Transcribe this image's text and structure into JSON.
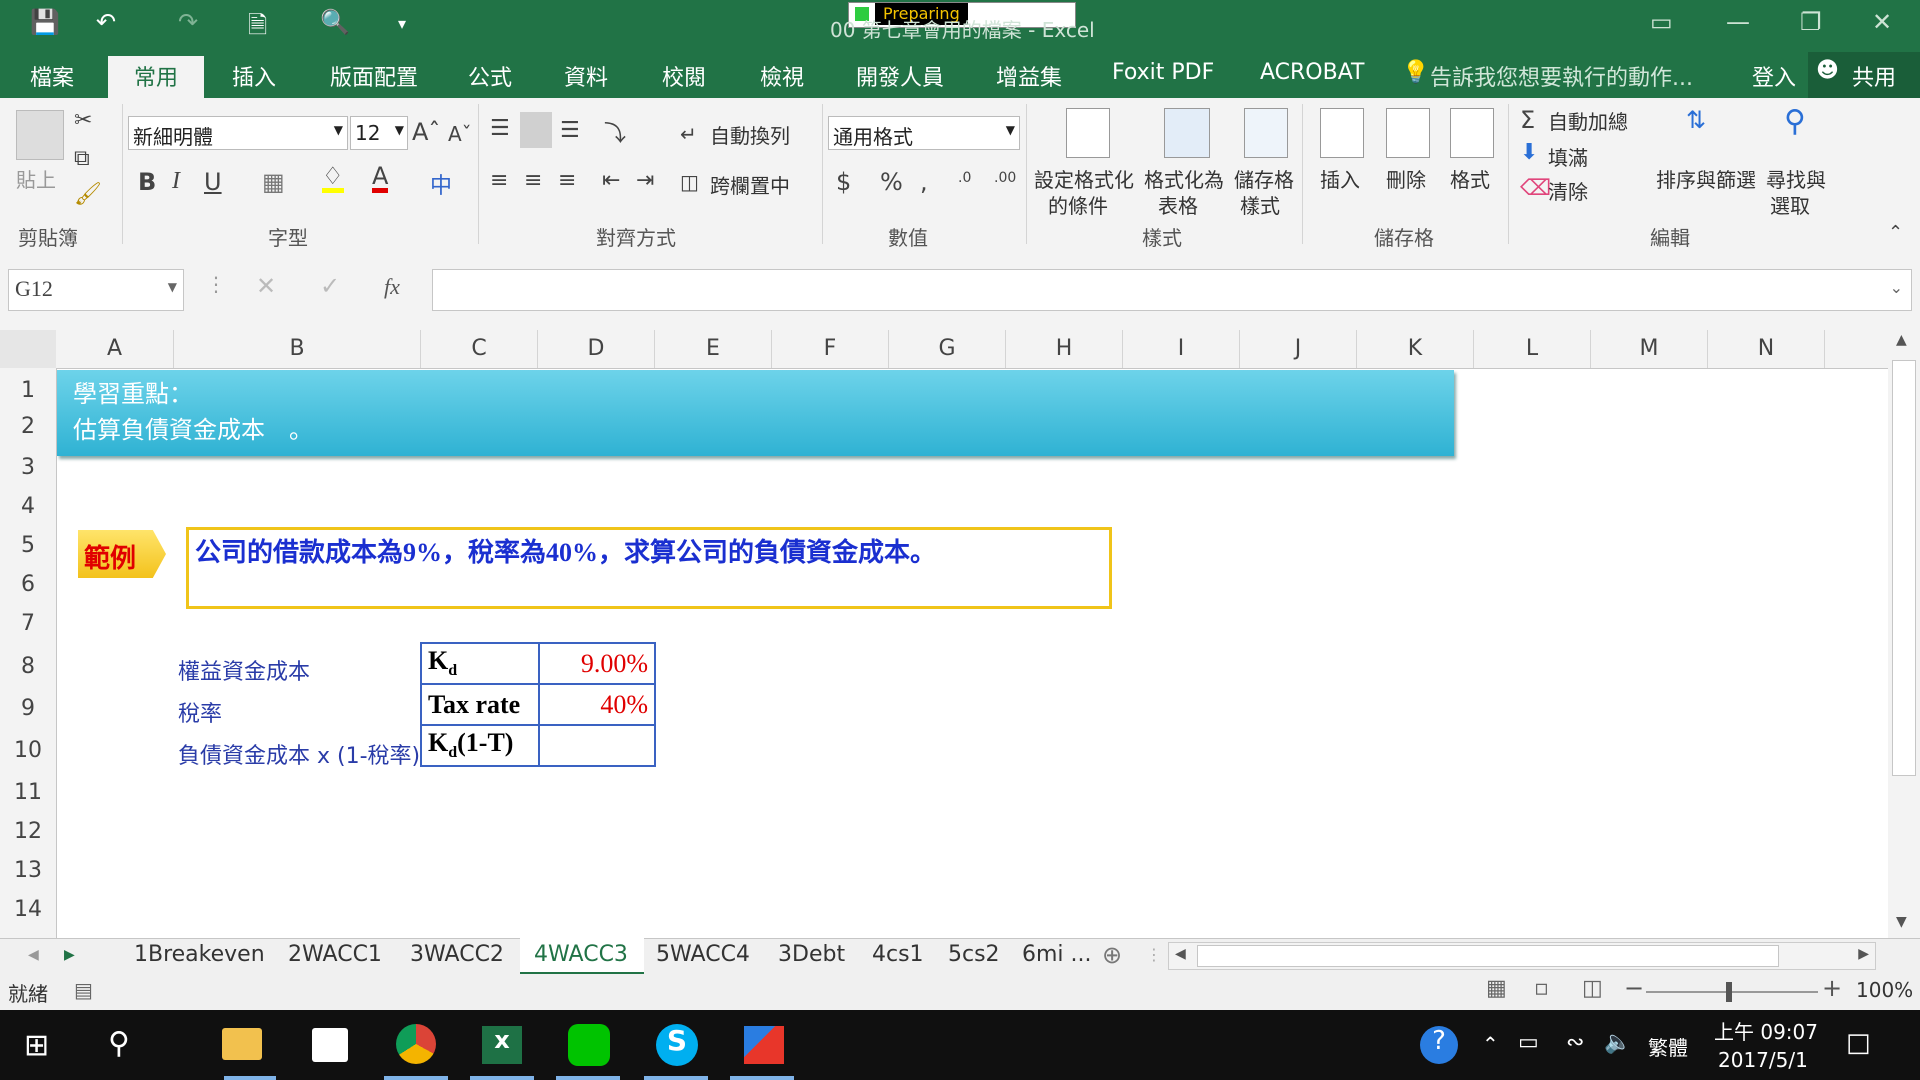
{
  "window": {
    "title": "00 第七章會用的檔案 - Excel",
    "status_popup": "Preparing"
  },
  "ribbon_tabs": [
    "檔案",
    "常用",
    "插入",
    "版面配置",
    "公式",
    "資料",
    "校閱",
    "檢視",
    "開發人員",
    "增益集",
    "Foxit PDF",
    "ACROBAT"
  ],
  "active_tab": "常用",
  "tellme": "告訴我您想要執行的動作...",
  "signin": "登入",
  "share": "共用",
  "ribbon": {
    "clipboard": {
      "paste": "貼上",
      "label": "剪貼簿"
    },
    "font": {
      "name": "新細明體",
      "size": "12",
      "label": "字型"
    },
    "alignment": {
      "wrap": "自動換列",
      "merge": "跨欄置中",
      "label": "對齊方式"
    },
    "number": {
      "format": "通用格式",
      "label": "數值"
    },
    "styles": {
      "cond_line1": "設定格式化",
      "cond_line2": "的條件",
      "table_line1": "格式化為",
      "table_line2": "表格",
      "cell_line1": "儲存格",
      "cell_line2": "樣式",
      "label": "樣式"
    },
    "cells": {
      "insert": "插入",
      "delete": "刪除",
      "format": "格式",
      "label": "儲存格"
    },
    "editing": {
      "autosum": "自動加總",
      "fill": "填滿",
      "clear": "清除",
      "sort_line1": "排序與篩選",
      "find_line1": "尋找與",
      "find_line2": "選取",
      "label": "編輯"
    }
  },
  "formula_bar": {
    "name_box": "G12",
    "fx": "fx",
    "value": ""
  },
  "columns": [
    "A",
    "B",
    "C",
    "D",
    "E",
    "F",
    "G",
    "H",
    "I",
    "J",
    "K",
    "L",
    "M",
    "N"
  ],
  "rows": [
    "1",
    "2",
    "3",
    "4",
    "5",
    "6",
    "7",
    "8",
    "9",
    "10",
    "11",
    "12",
    "13",
    "14"
  ],
  "sheet": {
    "banner_line1": "學習重點：",
    "banner_line2": "估算負債資金成本　。",
    "example_badge": "範例",
    "example_text": "公司的借款成本為9%，稅率為40%，求算公司的負債資金成本。",
    "labels": [
      "權益資金成本",
      "稅率",
      "負債資金成本 x (1-稅率)"
    ],
    "table": [
      {
        "key_main": "K",
        "key_sub": "d",
        "key_suffix": "",
        "value": "9.00%"
      },
      {
        "key_main": "Tax rate",
        "key_sub": "",
        "key_suffix": "",
        "value": "40%"
      },
      {
        "key_main": "K",
        "key_sub": "d",
        "key_suffix": "(1-T)",
        "value": ""
      }
    ]
  },
  "sheet_tabs": [
    "1Breakeven",
    "2WACC1",
    "3WACC2",
    "4WACC3",
    "5WACC4",
    "3Debt",
    "4cs1",
    "5cs2",
    "6mi ..."
  ],
  "active_sheet": "4WACC3",
  "status": {
    "ready": "就緒",
    "zoom": "100%"
  },
  "taskbar": {
    "time": "上午 09:07",
    "date": "2017/5/1",
    "ime": "繁體"
  }
}
